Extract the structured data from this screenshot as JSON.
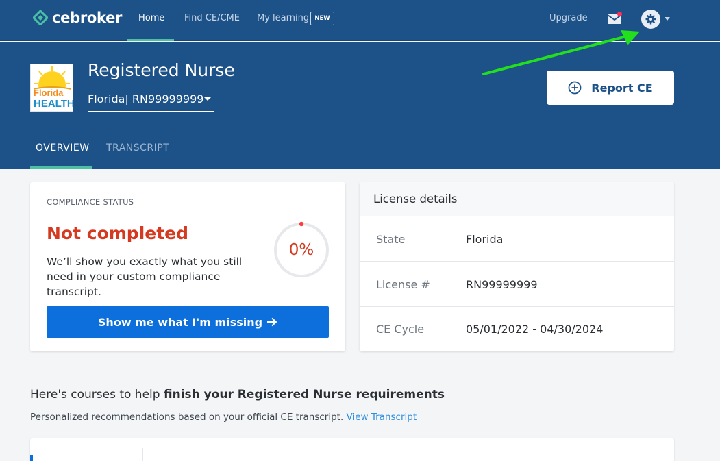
{
  "brand": {
    "name": "cebroker",
    "accent": "#4cc0a4",
    "primary": "#1d5289"
  },
  "nav": {
    "links": [
      {
        "label": "Home",
        "active": true
      },
      {
        "label": "Find CE/CME",
        "active": false
      },
      {
        "label": "My learning",
        "active": false
      }
    ],
    "new_badge": "NEW",
    "upgrade": "Upgrade",
    "icons": {
      "mail": "mail-icon",
      "settings": "gear-icon",
      "menu": "chevron-down-icon"
    },
    "notification_color": "#ff2f5a"
  },
  "header": {
    "state_logo": {
      "line1": "Florida",
      "line2": "HEALTH"
    },
    "profession": "Registered Nurse",
    "license_select": "Florida| RN99999999",
    "report_button": "Report CE",
    "tabs": [
      {
        "label": "OVERVIEW",
        "active": true
      },
      {
        "label": "TRANSCRIPT",
        "active": false
      }
    ]
  },
  "compliance": {
    "label": "COMPLIANCE STATUS",
    "status": "Not completed",
    "status_color": "#d53a20",
    "description": "We’ll show you exactly what you still need in your custom compliance transcript.",
    "progress_text": "0%",
    "progress_value": 0,
    "button": "Show me what I'm missing"
  },
  "license_details": {
    "title": "License details",
    "rows": [
      {
        "key": "State",
        "value": "Florida"
      },
      {
        "key": "License #",
        "value": "RN99999999"
      },
      {
        "key": "CE Cycle",
        "value": "05/01/2022 - 04/30/2024"
      }
    ]
  },
  "recommendations": {
    "title_prefix": "Here's courses to help ",
    "title_bold": "finish your Registered Nurse requirements",
    "subtitle": "Personalized recommendations based on your official CE transcript.",
    "link": "View Transcript"
  },
  "annotation": {
    "arrow_color": "#22e01c"
  }
}
